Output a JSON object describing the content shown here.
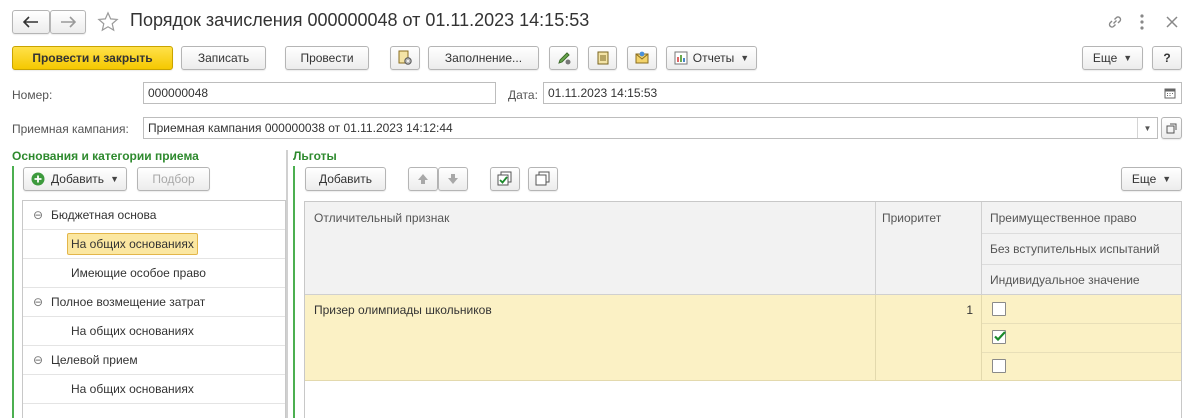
{
  "window": {
    "title": "Порядок зачисления 000000048 от 01.11.2023 14:15:53"
  },
  "toolbar": {
    "post_and_close": "Провести и закрыть",
    "write": "Записать",
    "post": "Провести",
    "fill": "Заполнение...",
    "reports": "Отчеты",
    "more": "Еще",
    "help": "?"
  },
  "form": {
    "number_label": "Номер:",
    "number_value": "000000048",
    "date_label": "Дата:",
    "date_value": "01.11.2023 14:15:53",
    "campaign_label": "Приемная кампания:",
    "campaign_value": "Приемная кампания 000000038 от 01.11.2023 14:12:44"
  },
  "left_panel": {
    "title": "Основания и категории приема",
    "add": "Добавить",
    "pick": "Подбор",
    "tree": [
      {
        "label": "Бюджетная основа",
        "level": 0,
        "group": true
      },
      {
        "label": "На общих основаниях",
        "level": 1,
        "selected": true
      },
      {
        "label": "Имеющие особое право",
        "level": 1
      },
      {
        "label": "Полное возмещение затрат",
        "level": 0,
        "group": true
      },
      {
        "label": "На общих основаниях",
        "level": 1
      },
      {
        "label": "Целевой прием",
        "level": 0,
        "group": true
      },
      {
        "label": "На общих основаниях",
        "level": 1
      }
    ]
  },
  "right_panel": {
    "title": "Льготы",
    "add": "Добавить",
    "more": "Еще",
    "columns": {
      "feature": "Отличительный признак",
      "priority": "Приоритет",
      "advantage": "Преимущественное право",
      "no_exams": "Без вступительных испытаний",
      "individual": "Индивидуальное значение"
    },
    "rows": [
      {
        "feature": "Призер олимпиады школьников",
        "priority": "1",
        "advantage": false,
        "no_exams": true,
        "individual": false
      }
    ]
  },
  "colors": {
    "accent_yellow": "#f5c800",
    "section_green": "#2e8a2e",
    "selected_row": "#fbf1c5",
    "check_green": "#1a8a2a"
  }
}
